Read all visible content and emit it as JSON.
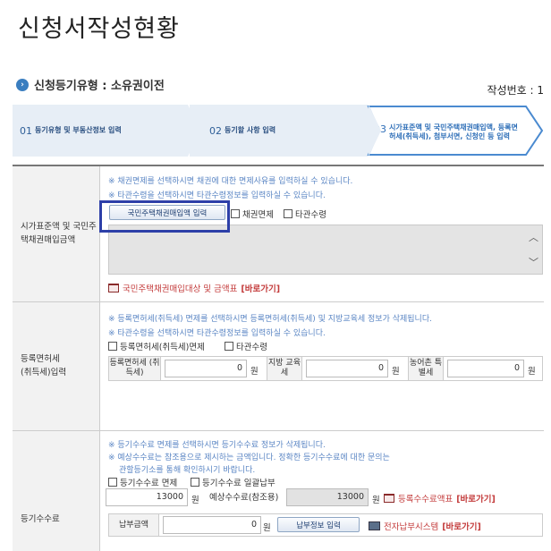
{
  "page_title": "신청서작성현황",
  "reg_type": "신청등기유형 : 소유권이전",
  "doc_no": "작성번호 : 1",
  "steps": [
    {
      "num": "01",
      "label": "등기유형 및 부동산정보 입력"
    },
    {
      "num": "02",
      "label": "등기할 사항 입력"
    },
    {
      "num": "03",
      "label": "시가표준액 및 국민주택채권매입액, 등록면허세(취득세), 첨부서면, 신청인 등 입력"
    }
  ],
  "section1": {
    "label": "시가표준액 및 국민주택채권매입금액",
    "note1": "※ 채권면제를 선택하시면 채권에 대한 면제사유를 입력하실 수 있습니다.",
    "note2": "※ 타관수령을 선택하시면 타관수령정보를 입력하실 수 있습니다.",
    "button": "국민주택채권매입액 입력",
    "cb1": "채권면제",
    "cb2": "타관수령",
    "link_text": "국민주택채권매입대상 및 금액표",
    "link_go": "[바로가기]"
  },
  "section2": {
    "label": "등록면허세 (취득세)입력",
    "note1": "※ 등록면허세(취득세) 면제를 선택하시면 등록면허세(취득세) 및 지방교육세 정보가 삭제됩니다.",
    "note2": "※ 타관수령을 선택하시면 타관수령정보를 입력하실 수 있습니다.",
    "cb1": "등록면허세(취득세)면제",
    "cb2": "타관수령",
    "f1_label": "등록면허세 (취득세)",
    "f1_value": "0",
    "f2_label": "지방 교육세",
    "f2_value": "0",
    "f3_label": "농어촌 특별세",
    "f3_value": "0",
    "unit": "원"
  },
  "section3": {
    "label": "등기수수료",
    "note1": "※ 등기수수료 면제를 선택하시면 등기수수료 정보가 삭제됩니다.",
    "note2": "※ 예상수수료는 참조용으로 제시하는 금액입니다. 정확한 등기수수료에 대한 문의는",
    "note3": "관할등기소를 통해 확인하시기 바랍니다.",
    "cb1": "등기수수료 면제",
    "cb2": "등기수수료 일괄납부",
    "fee_value": "13000",
    "unit": "원",
    "expected_label": "예상수수료(참조용)",
    "expected_value": "13000",
    "fee_table_link": "등록수수료액표",
    "fee_table_go": "[바로가기]",
    "paid_label": "납부금액",
    "paid_value": "0",
    "pay_button": "납부정보 입력",
    "e_pay_link": "전자납부시스템",
    "e_pay_go": "[바로가기]"
  }
}
